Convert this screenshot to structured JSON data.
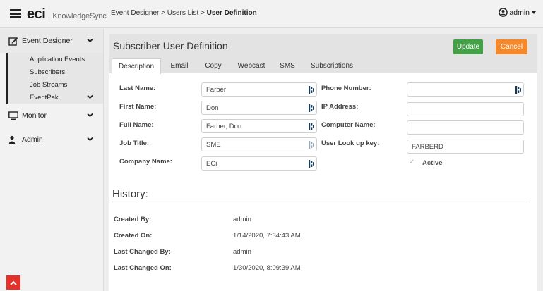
{
  "header": {
    "logo_brand": "eci",
    "logo_product": "KnowledgeSync",
    "breadcrumb_path": "Event Designer > Users List > ",
    "breadcrumb_current": "User Definition",
    "user_label": "admin"
  },
  "sidebar": {
    "groups": [
      {
        "label": "Event Designer",
        "icon": "edit-icon"
      },
      {
        "label": "Monitor",
        "icon": "monitor-icon"
      },
      {
        "label": "Admin",
        "icon": "user-icon"
      }
    ],
    "event_designer_items": [
      "Application Events",
      "Subscribers",
      "Job Streams",
      "EventPak"
    ]
  },
  "panel": {
    "title": "Subscriber User Definition",
    "update_label": "Update",
    "cancel_label": "Cancel",
    "tabs": [
      "Description",
      "Email",
      "Copy",
      "Webcast",
      "SMS",
      "Subscriptions"
    ],
    "active_tab": "Description"
  },
  "form": {
    "last_name_label": "Last Name:",
    "last_name": "Farber",
    "first_name_label": "First Name:",
    "first_name": "Don",
    "full_name_label": "Full Name:",
    "full_name": "Farber, Don",
    "job_title_label": "Job Title:",
    "job_title": "SME",
    "company_name_label": "Company Name:",
    "company_name": "ECi",
    "phone_label": "Phone Number:",
    "phone": "",
    "ip_label": "IP Address:",
    "ip": "",
    "computer_label": "Computer Name:",
    "computer": "",
    "lookup_label": "User Look up key:",
    "lookup": "FARBERD",
    "active_label": "Active",
    "active_checked": true
  },
  "history": {
    "title": "History:",
    "created_by_label": "Created By:",
    "created_by": "admin",
    "created_on_label": "Created On:",
    "created_on": "1/14/2020, 7:34:43 AM",
    "last_changed_by_label": "Last Changed By:",
    "last_changed_by": "admin",
    "last_changed_on_label": "Last Changed On:",
    "last_changed_on": "1/30/2020, 8:09:39 AM"
  },
  "colors": {
    "update_button": "#43a047",
    "cancel_button": "#f5882a",
    "scroll_top_button": "#e4322b"
  }
}
